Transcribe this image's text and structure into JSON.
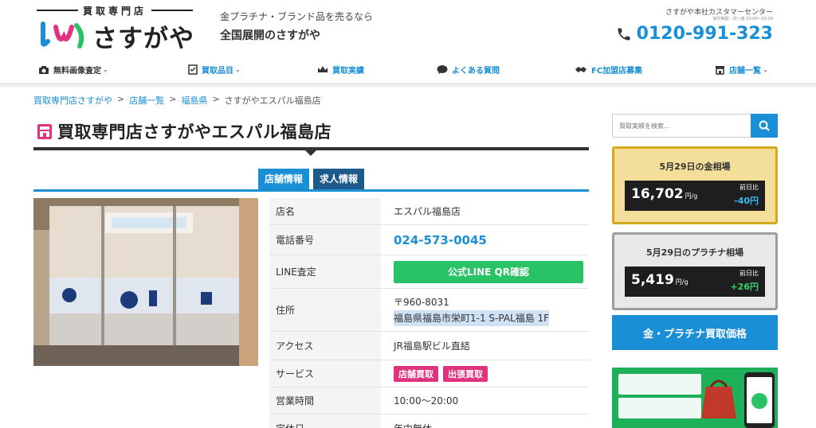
{
  "header": {
    "logo_top": "買取専門店",
    "logo_name": "さすがや",
    "tagline": "金プラチナ・ブランド品を売るなら",
    "tagline2": "全国展開のさすがや",
    "customer_center": "さすがや本社カスタマーセンター",
    "hours": "受付時間｜月～金 10:00～19:00",
    "phone": "0120-991-323"
  },
  "nav": [
    {
      "label": "無料画像査定",
      "icon": "camera-icon",
      "chevron": "⌄"
    },
    {
      "label": "買取品目",
      "icon": "checklist-icon",
      "chevron": "⌄"
    },
    {
      "label": "買取実績",
      "icon": "crown-icon",
      "chevron": ""
    },
    {
      "label": "よくある質問",
      "icon": "chat-bubble-icon",
      "chevron": ""
    },
    {
      "label": "FC加盟店募集",
      "icon": "handshake-icon",
      "chevron": ""
    },
    {
      "label": "店舗一覧",
      "icon": "store-icon",
      "chevron": "⌄"
    }
  ],
  "breadcrumb": {
    "items": [
      "買取専門店さすがや",
      "店舗一覧",
      "福島県"
    ],
    "current": "さすがやエスパル福島店",
    "separator": ">"
  },
  "page_title": "買取専門店さすがやエスパル福島店",
  "tabs": [
    "店舗情報",
    "求人情報"
  ],
  "store_info": {
    "name_label": "店名",
    "name": "エスパル福島店",
    "phone_label": "電話番号",
    "phone": "024-573-0045",
    "line_label": "LINE査定",
    "line_button": "公式LINE QR確認",
    "address_label": "住所",
    "postal": "〒960-8031",
    "address": "福島県福島市栄町1-1 S-PAL福島 1F",
    "access_label": "アクセス",
    "access": "JR福島駅ビル直結",
    "service_label": "サービス",
    "services": [
      "店舗買取",
      "出張買取"
    ],
    "hours_label": "営業時間",
    "hours": "10:00～20:00",
    "holiday_label": "定休日",
    "holiday": "年中無休"
  },
  "sidebar": {
    "search_placeholder": "買取実績を検索...",
    "gold": {
      "title": "5月29日の金相場",
      "price": "16,702",
      "unit": "円/g",
      "diff_label": "前日比",
      "diff": "-40円"
    },
    "platinum": {
      "title": "5月29日のプラチナ相場",
      "price": "5,419",
      "unit": "円/g",
      "diff_label": "前日比",
      "diff": "+26円"
    },
    "price_button": "金・プラチナ買取価格"
  },
  "colors": {
    "accent": "#1a8fd6",
    "navy": "#1d5a8c",
    "line_green": "#29c264",
    "badge_pink": "#e0337d",
    "gold_bg": "#f3df9a",
    "gold_border": "#d5a91f"
  }
}
